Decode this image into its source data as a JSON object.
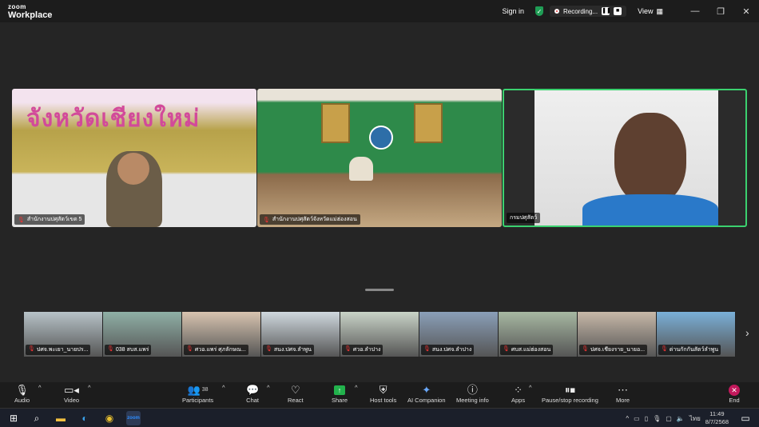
{
  "app": {
    "logo_line1": "zoom",
    "logo_line2": "Workplace"
  },
  "titlebar": {
    "signin": "Sign in",
    "recording": "Recording...",
    "view": "View"
  },
  "tiles": [
    {
      "label": "สำนักงานปศุสัตว์เขต 5",
      "banner": "จังหวัดเชียงใหม่"
    },
    {
      "label": "สำนักงานปศุสัตว์จังหวัดแม่ฮ่องสอน"
    },
    {
      "label": "กรมปศุสัตว์"
    }
  ],
  "thumbnails": [
    {
      "label": "ปศจ.พะเยา_นายปร...",
      "color": "#b7c3c8"
    },
    {
      "label": "038 สบส.แพร่",
      "color": "#8fb0a6"
    },
    {
      "label": "ศวอ.แพร่ ศุภลักษณ...",
      "color": "#d8c4b0"
    },
    {
      "label": "สนง.ปศจ.ลำพูน",
      "color": "#cfd8de"
    },
    {
      "label": "ศวอ.ลำปาง",
      "color": "#c9d3c7"
    },
    {
      "label": "สนง.ปศจ.ลำปาง",
      "color": "#8a9fb8"
    },
    {
      "label": "ศบส.แม่ฮ่องสอน",
      "color": "#a7b8a2"
    },
    {
      "label": "ปศจ.เชียงราย_นายอ...",
      "color": "#c7b8a8"
    },
    {
      "label": "ด่านกักกันสัตว์ลำพูน",
      "color": "#7ab0d8"
    }
  ],
  "toolbar": {
    "audio": "Audio",
    "video": "Video",
    "participants": "Participants",
    "participants_count": "38",
    "chat": "Chat",
    "react": "React",
    "share": "Share",
    "host_tools": "Host tools",
    "ai_companion": "AI Companion",
    "meeting_info": "Meeting info",
    "apps": "Apps",
    "pause_recording": "Pause/stop recording",
    "more": "More",
    "end": "End"
  },
  "taskbar": {
    "time": "11:49",
    "date": "8/7/2568",
    "language": "ไทย"
  }
}
